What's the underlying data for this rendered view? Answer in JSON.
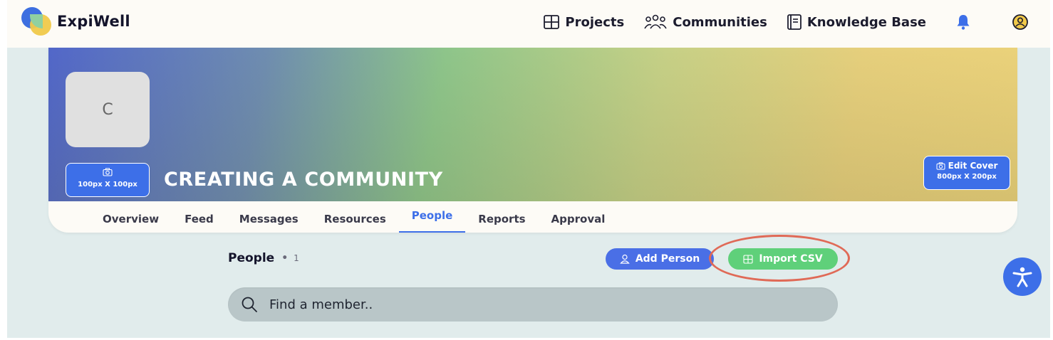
{
  "app": {
    "brand": "ExpiWell"
  },
  "nav": {
    "projects": "Projects",
    "communities": "Communities",
    "knowledge_base": "Knowledge Base"
  },
  "community": {
    "avatar_initial": "C",
    "avatar_upload_size": "100px X 100px",
    "title": "CREATING A COMMUNITY",
    "edit_cover_label": "Edit Cover",
    "edit_cover_size": "800px X 200px"
  },
  "tabs": [
    {
      "label": "Overview",
      "active": false
    },
    {
      "label": "Feed",
      "active": false
    },
    {
      "label": "Messages",
      "active": false
    },
    {
      "label": "Resources",
      "active": false
    },
    {
      "label": "People",
      "active": true
    },
    {
      "label": "Reports",
      "active": false
    },
    {
      "label": "Approval",
      "active": false
    }
  ],
  "people": {
    "heading": "People",
    "separator": "•",
    "count": "1",
    "add_person_label": "Add Person",
    "import_csv_label": "Import CSV",
    "search_placeholder": "Find a member.."
  },
  "colors": {
    "accent_blue": "#3d6fe8",
    "import_green": "#5fd07a",
    "highlight_ring": "#e06a57",
    "page_background": "#e1ecec"
  },
  "icons": {
    "projects": "grid-icon",
    "communities": "people-group-icon",
    "knowledge_base": "document-icon",
    "notifications": "bell-icon",
    "profile": "user-avatar-icon",
    "upload": "camera-icon",
    "add_person": "person-icon",
    "import_csv": "table-icon",
    "search": "search-icon",
    "accessibility": "accessibility-icon"
  }
}
